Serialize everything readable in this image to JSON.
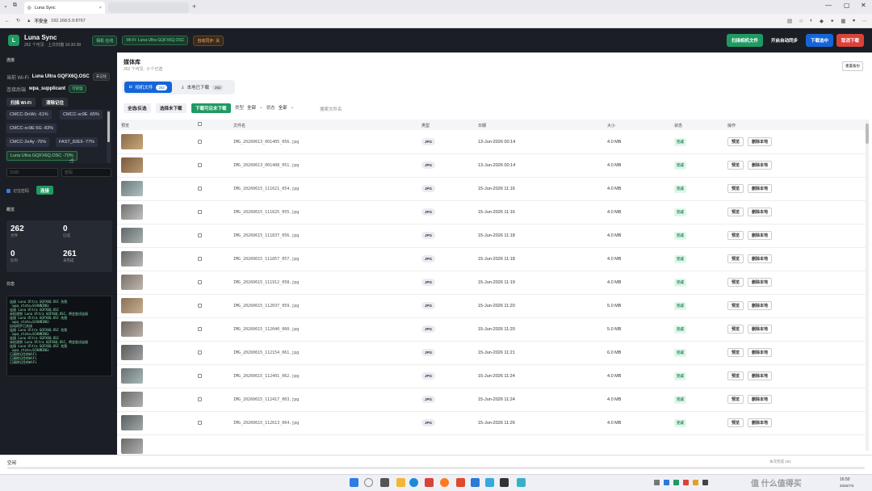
{
  "browser": {
    "tab_title": "Luna Sync",
    "security_label": "不安全",
    "url": "192.168.5.9:8767",
    "tab_close": "×",
    "new_tab": "+"
  },
  "header": {
    "logo_letter": "L",
    "app_name": "Luna Sync",
    "subtitle": "262 个可见 · 上次扫描 16:39:38",
    "chip_camera": "相机 在线",
    "chip_wifi": "Wi-Fi: Luna Ultra GQFX6Q.OSC",
    "chip_autosync": "自动同步: 关",
    "btn_scan": "扫描相机文件",
    "btn_autosync": "开启自动同步",
    "btn_download": "下载选中",
    "btn_cancel": "取消下载"
  },
  "sidebar": {
    "conn_title": "连接",
    "current_wifi_label": "当前 Wi-Fi",
    "current_wifi_value": "Luna Ultra GQFX6Q.OSC",
    "current_wifi_badge": "未记住",
    "backend_label": "连接后端",
    "backend_value": "wpa_supplicant",
    "backend_badge": "可管理",
    "btn_scan_wifi": "扫描 Wi-Fi",
    "btn_forget": "清除记住",
    "networks": [
      "CMCC-DnWc -61%",
      "CMCC-xc9E -65%",
      "CMCC-xc9E-5G -83%",
      "CMCC-2eAy -75%",
      "FAST_82E6 -77%",
      "Luna Ultra GQFX6Q.OSC -70%"
    ],
    "ssid_placeholder": "SSID",
    "pwd_placeholder": "密码",
    "remember_label": "记住密码",
    "btn_connect": "连接",
    "overview_title": "概览",
    "stats": [
      {
        "value": "262",
        "label": "文件"
      },
      {
        "value": "0",
        "label": "已选"
      },
      {
        "value": "0",
        "label": "队列"
      },
      {
        "value": "261",
        "label": "未完成"
      }
    ],
    "log_title": "日志",
    "log_lines": [
      "连接 Luna Ultra GQFX6Q.OSC 失败",
      "（wpa_state=SCANNING）",
      "连接 Luna Ultra GQFX6Q.OSC",
      "未检测到 Luna Ultra GQFX6Q.OSC，将会尝试连接",
      "连接 Luna Ultra GQFX6Q.OSC 失败",
      "（wpa_state=SCANNING）",
      "自动同步已关闭",
      "连接 Luna Ultra GQFX6Q.OSC 失败",
      "（wpa_state=SCANNING）",
      "连接 Luna Ultra GQFX6Q.OSC",
      "未检测到 Luna Ultra GQFX6Q.OSC，将会尝试连接",
      "连接 Luna Ultra GQFX6Q.OSC 失败",
      "（wpa_state=SCANNING）",
      "已清除记住的WiFi",
      "已清除记住的WiFi",
      "已清除记住的WiFi"
    ]
  },
  "main": {
    "title": "媒体库",
    "subtitle": "262 个可见 · 0 个已选",
    "refresh_btn": "重置备份",
    "tabs": [
      {
        "label": "相机文件",
        "count": "262"
      },
      {
        "label": "本地已下载",
        "count": "262"
      }
    ],
    "btn_select_all": "全选/反选",
    "btn_select_undl": "选择未下载",
    "btn_download_visible": "下载可见未下载",
    "type_label": "类型",
    "type_value": "全部",
    "status_label": "状态",
    "status_value": "全部",
    "search_placeholder": "搜索文件名",
    "columns": [
      "预览",
      "",
      "文件名",
      "类型",
      "日期",
      "大小",
      "状态",
      "操作"
    ],
    "row_btn_preview": "预览",
    "row_btn_delete": "删除本地",
    "rows": [
      {
        "file": "IMG_20260613_001405_056.jpg",
        "type": "JPG",
        "date": "13-Jun-2026 00:14",
        "size": "4.0 MB",
        "status": "完成"
      },
      {
        "file": "IMG_20260613_001408_051.jpg",
        "type": "JPG",
        "date": "13-Jun-2026 00:14",
        "size": "4.0 MB",
        "status": "完成"
      },
      {
        "file": "IMG_20260615_111621_054.jpg",
        "type": "JPG",
        "date": "15-Jun-2026 11:16",
        "size": "4.0 MB",
        "status": "完成"
      },
      {
        "file": "IMG_20260615_111625_055.jpg",
        "type": "JPG",
        "date": "15-Jun-2026 11:16",
        "size": "4.0 MB",
        "status": "完成"
      },
      {
        "file": "IMG_20260615_111837_056.jpg",
        "type": "JPG",
        "date": "15-Jun-2026 11:18",
        "size": "4.0 MB",
        "status": "完成"
      },
      {
        "file": "IMG_20260615_111857_057.jpg",
        "type": "JPG",
        "date": "15-Jun-2026 11:18",
        "size": "4.0 MB",
        "status": "完成"
      },
      {
        "file": "IMG_20260615_111912_058.jpg",
        "type": "JPG",
        "date": "15-Jun-2026 11:19",
        "size": "4.0 MB",
        "status": "完成"
      },
      {
        "file": "IMG_20260615_112037_059.jpg",
        "type": "JPG",
        "date": "15-Jun-2026 11:20",
        "size": "5.0 MB",
        "status": "完成"
      },
      {
        "file": "IMG_20260615_112040_060.jpg",
        "type": "JPG",
        "date": "15-Jun-2026 11:20",
        "size": "5.0 MB",
        "status": "完成"
      },
      {
        "file": "IMG_20260615_112154_061.jpg",
        "type": "JPG",
        "date": "15-Jun-2026 11:21",
        "size": "6.0 MB",
        "status": "完成"
      },
      {
        "file": "IMG_20260615_112401_062.jpg",
        "type": "JPG",
        "date": "15-Jun-2026 11:24",
        "size": "4.0 MB",
        "status": "完成"
      },
      {
        "file": "IMG_20260615_112417_063.jpg",
        "type": "JPG",
        "date": "15-Jun-2026 11:24",
        "size": "4.0 MB",
        "status": "完成"
      },
      {
        "file": "IMG_20260615_112613_064.jpg",
        "type": "JPG",
        "date": "15-Jun-2026 11:26",
        "size": "4.0 MB",
        "status": "完成"
      },
      {
        "file": "",
        "type": "",
        "date": "",
        "size": "",
        "status": ""
      }
    ]
  },
  "footer": {
    "status_text": "空闲",
    "right_text": "本次完成 261"
  },
  "taskbar": {
    "time": "16:50",
    "date": "2026/7/4",
    "watermark": "值 什么值得买"
  },
  "colors": {
    "accent_green": "#1f9a62",
    "accent_blue": "#1565d8",
    "danger_red": "#d9433a",
    "header_dark": "#1b1e24"
  }
}
